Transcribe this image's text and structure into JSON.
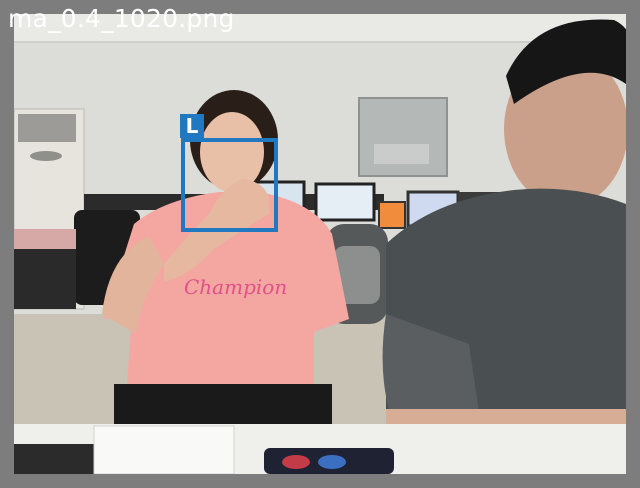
{
  "window": {
    "title": "ma_0.4_1020.png"
  },
  "detection": {
    "label": "L",
    "color": "#1f78c0"
  },
  "scene": {
    "shirt_text": "Champion"
  }
}
